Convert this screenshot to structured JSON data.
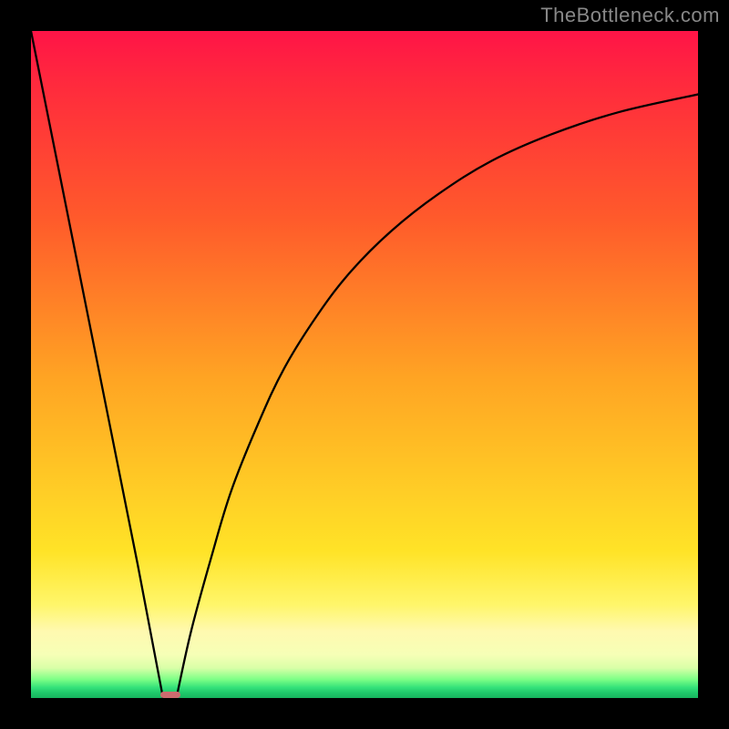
{
  "watermark": "TheBottleneck.com",
  "chart_data": {
    "type": "line",
    "title": "",
    "xlabel": "",
    "ylabel": "",
    "xlim": [
      0,
      100
    ],
    "ylim": [
      0,
      100
    ],
    "grid": false,
    "legend": false,
    "series": [
      {
        "name": "left-branch",
        "x": [
          0,
          4,
          8,
          12,
          16,
          19.8
        ],
        "y": [
          100,
          80,
          60,
          40,
          20,
          0
        ]
      },
      {
        "name": "right-branch",
        "x": [
          21.8,
          24,
          27,
          30,
          34,
          38,
          43,
          48,
          54,
          61,
          69,
          78,
          88,
          100
        ],
        "y": [
          0,
          10,
          21,
          31,
          41,
          49.5,
          57.5,
          64,
          70,
          75.5,
          80.5,
          84.5,
          87.8,
          90.5
        ]
      }
    ],
    "marker": {
      "name": "optimal-point",
      "x_center": 20.9,
      "y": 0,
      "width_pct": 3.1,
      "height_pct": 1.0,
      "color": "#cc6b6f"
    },
    "background_gradient": {
      "stops": [
        {
          "pos": 0.0,
          "color": "#ff1447"
        },
        {
          "pos": 0.28,
          "color": "#ff5a2b"
        },
        {
          "pos": 0.52,
          "color": "#ffa423"
        },
        {
          "pos": 0.78,
          "color": "#ffe327"
        },
        {
          "pos": 0.9,
          "color": "#fff9b0"
        },
        {
          "pos": 0.97,
          "color": "#7dff86"
        },
        {
          "pos": 1.0,
          "color": "#17b45e"
        }
      ]
    }
  }
}
